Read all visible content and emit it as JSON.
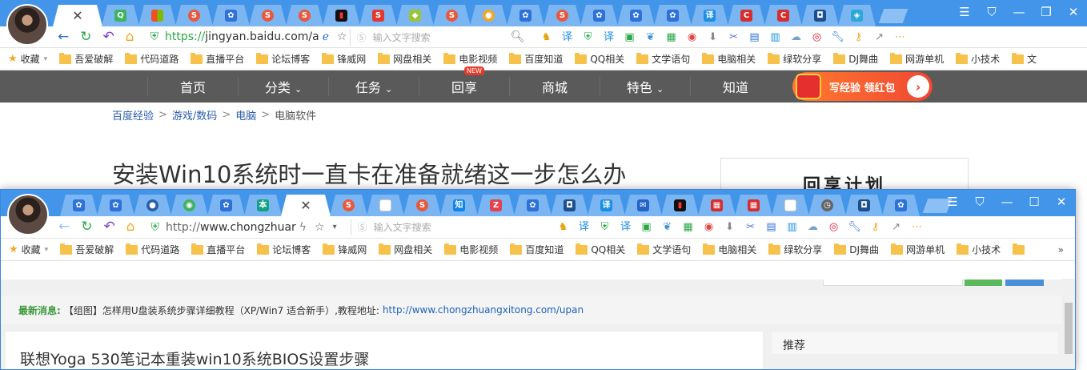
{
  "window1": {
    "active_tab_close": "✕",
    "url_prefix": "https://",
    "url_host": "jingyan.baidu.com/a",
    "search_placeholder": "输入文字搜索",
    "bookmarks": [
      "收藏",
      "吾爱破解",
      "代码道路",
      "直播平台",
      "论坛博客",
      "锋威网",
      "网盘相关",
      "电影视频",
      "百度知道",
      "QQ相关",
      "文学语句",
      "电脑相关",
      "绿软分享",
      "DJ舞曲",
      "网游单机",
      "小技术",
      "文"
    ],
    "nav": [
      "首页",
      "分类",
      "任务",
      "回享",
      "商城",
      "特色",
      "知道"
    ],
    "nav_dropdown_marks": [
      "",
      "⌄",
      "⌄",
      "",
      "",
      "⌄",
      ""
    ],
    "new_badge": "NEW",
    "promo_text": "写经验 领红包",
    "breadcrumb": [
      "百度经验",
      "游戏/数码",
      "电脑",
      "电脑软件"
    ],
    "article_title": "安装Win10系统时一直卡在准备就绪这一步怎么办",
    "side_ad_text": "回享计划"
  },
  "window2": {
    "url_prefix": "http://",
    "url_host": "www.chongzhuar",
    "search_placeholder": "输入文字搜索",
    "bookmarks": [
      "收藏",
      "吾爱破解",
      "代码道路",
      "直播平台",
      "论坛博客",
      "锋威网",
      "网盘相关",
      "电影视频",
      "百度知道",
      "QQ相关",
      "文学语句",
      "电脑相关",
      "绿软分享",
      "DJ舞曲",
      "网游单机",
      "小技术",
      ""
    ],
    "news_label": "最新消息:",
    "news_text": "【组图】怎样用U盘装系统步骤详细教程（XP/Win7 适合新手）,教程地址:",
    "news_link": "http://www.chongzhuangxitong.com/upan",
    "page_title": "联想Yoga 530笔记本重装win10系统BIOS设置步骤",
    "recommend": "推荐"
  },
  "colors": {
    "tabbar": "#4295e9",
    "navbar": "#5a5a5a",
    "accent_green": "#2aa744",
    "link": "#1c62b9"
  },
  "icons": [
    "back-arrow-icon",
    "refresh-icon",
    "undo-icon",
    "home-icon",
    "shield-icon",
    "star-icon",
    "search-icon",
    "translate-icon",
    "weibo-icon",
    "wrench-icon",
    "key-icon",
    "more-icon"
  ]
}
